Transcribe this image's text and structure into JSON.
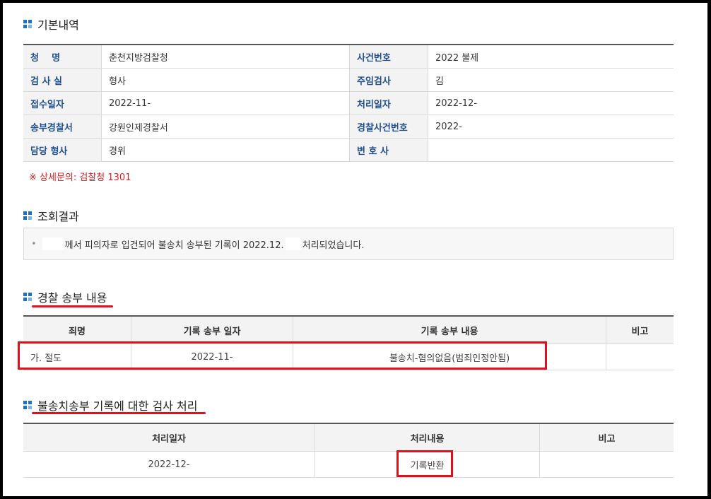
{
  "basic": {
    "title": "기본내역",
    "rows": [
      {
        "l1": "청    명",
        "v1": "춘천지방검찰청",
        "l2": "사건번호",
        "v2": "2022 불제"
      },
      {
        "l1": "검 사 실",
        "v1": "형사",
        "l2": "주임검사",
        "v2": "김"
      },
      {
        "l1": "접수일자",
        "v1": "2022-11-",
        "l2": "처리일자",
        "v2": "2022-12-"
      },
      {
        "l1": "송부경찰서",
        "v1": "강원인제경찰서",
        "l2": "경찰사건번호",
        "v2": "2022-"
      },
      {
        "l1": "담당 형사",
        "v1": "경위",
        "l2": "변 호 사",
        "v2": ""
      }
    ],
    "note": "※ 상세문의: 검찰청 1301"
  },
  "result": {
    "title": "조회결과",
    "text_a": "께서 피의자로 입건되어 불송치 송부된 기록이 2022.12.",
    "text_b": "처리되었습니다."
  },
  "police": {
    "title": "경찰 송부 내용",
    "headers": [
      "죄명",
      "기록 송부 일자",
      "기록 송부 내용",
      "비고"
    ],
    "row": [
      "가. 절도",
      "2022-11-",
      "불송치-혐의없음(범죄인정안됨)",
      ""
    ]
  },
  "prosecutor": {
    "title": "불송치송부 기록에 대한 검사 처리",
    "headers": [
      "처리일자",
      "처리내용",
      "비고"
    ],
    "row": [
      "2022-12-",
      "기록반환",
      ""
    ]
  },
  "colors": {
    "accent": "#1f6fc5",
    "label": "#1f4e8c",
    "highlight": "#e0101c",
    "note": "#e02020"
  }
}
